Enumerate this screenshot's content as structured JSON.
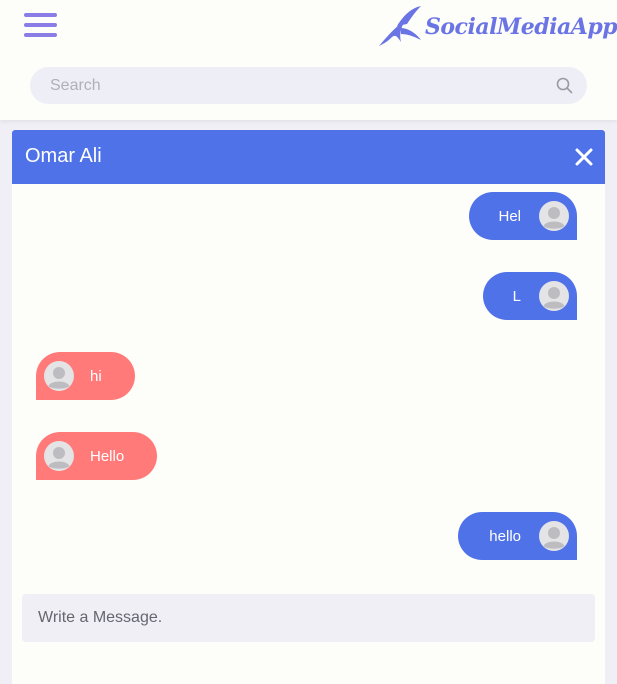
{
  "app": {
    "name": "SocialMediaApp"
  },
  "header": {
    "menu_icon": "hamburger-icon",
    "search": {
      "placeholder": "Search",
      "value": "",
      "icon": "search-icon"
    }
  },
  "chat": {
    "title": "Omar Ali",
    "close_icon": "close-icon",
    "messages": [
      {
        "direction": "sent",
        "text": "Hel"
      },
      {
        "direction": "sent",
        "text": "L"
      },
      {
        "direction": "received",
        "text": "hi"
      },
      {
        "direction": "received",
        "text": "Hello"
      },
      {
        "direction": "sent",
        "text": "hello"
      }
    ],
    "compose": {
      "placeholder": "Write a Message.",
      "value": ""
    }
  },
  "colors": {
    "accent": "#5072e8",
    "received_bubble": "#ff7a78",
    "menu_icon": "#8b7de6",
    "logo": "#6a74e4"
  }
}
